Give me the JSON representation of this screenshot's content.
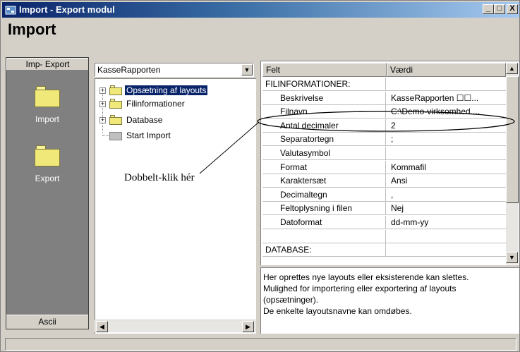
{
  "window": {
    "title": "Import - Export modul",
    "buttons": {
      "minimize": "_",
      "maximize": "□",
      "close": "X"
    }
  },
  "header": {
    "title": "Import"
  },
  "left_panel": {
    "header": "Imp- Export",
    "items": [
      {
        "label": "Import",
        "icon": "folder-icon"
      },
      {
        "label": "Export",
        "icon": "folder-icon"
      }
    ],
    "footer": "Ascii"
  },
  "layout_select": {
    "value": "KasseRapporten"
  },
  "tree": {
    "items": [
      {
        "label": "Opsætning af layouts",
        "selected": true
      },
      {
        "label": "Filinformationer",
        "selected": false
      },
      {
        "label": "Database",
        "selected": false
      },
      {
        "label": "Start Import",
        "selected": false
      }
    ]
  },
  "property_grid": {
    "headers": [
      "Felt",
      "Værdi"
    ],
    "rows": [
      {
        "key": "FILINFORMATIONER:",
        "value": ""
      },
      {
        "key": "Beskrivelse",
        "value": "KasseRapporten ☐☐..."
      },
      {
        "key": "Filnavn",
        "value": "C:\\Demo-virksomhed...."
      },
      {
        "key": "Antal decimaler",
        "value": "2"
      },
      {
        "key": "Separatortegn",
        "value": ";"
      },
      {
        "key": "Valutasymbol",
        "value": ""
      },
      {
        "key": "Format",
        "value": "Kommafil"
      },
      {
        "key": "Karaktersæt",
        "value": "Ansi"
      },
      {
        "key": "Decimaltegn",
        "value": ","
      },
      {
        "key": "Feltoplysning i filen",
        "value": "Nej"
      },
      {
        "key": "Datoformat",
        "value": "dd-mm-yy"
      },
      {
        "key": "",
        "value": ""
      },
      {
        "key": "DATABASE:",
        "value": ""
      }
    ]
  },
  "description": {
    "lines": [
      "Her oprettes nye layouts eller eksisterende kan slettes.",
      "Mulighed for importering eller exportering af layouts",
      "(opsætninger).",
      "De enkelte layoutsnavne kan omdøbes."
    ]
  },
  "annotation": {
    "text": "Dobbelt-klik hér"
  },
  "colors": {
    "titlebar": "#0a246a",
    "selection": "#0a246a",
    "left_panel": "#808080",
    "face": "#d4d0c8"
  }
}
